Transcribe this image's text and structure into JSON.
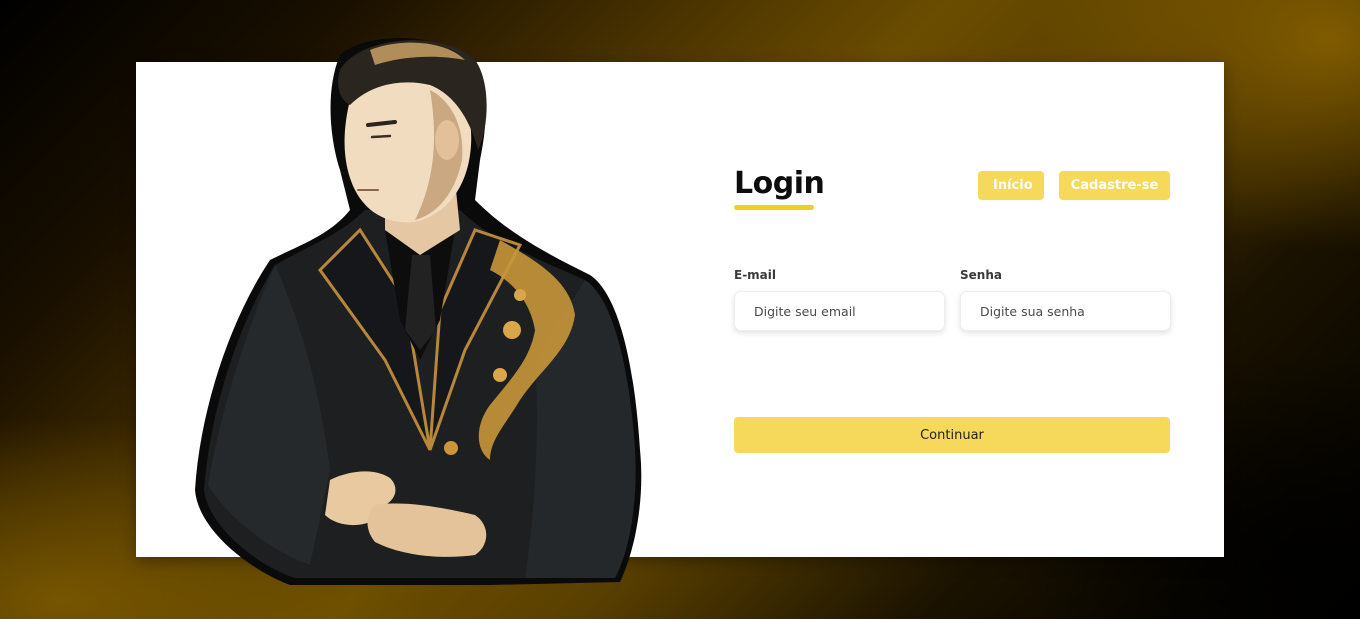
{
  "login": {
    "title": "Login",
    "nav": {
      "home_label": "Início",
      "signup_label": "Cadastre-se"
    },
    "email": {
      "label": "E-mail",
      "placeholder": "Digite seu email"
    },
    "password": {
      "label": "Senha",
      "placeholder": "Digite sua senha"
    },
    "submit_label": "Continuar"
  },
  "illustration": {
    "icon": "man-in-suit-illustration"
  },
  "colors": {
    "accent": "#f6d95a",
    "underline": "#f2cf1f",
    "background_gold": "#6b4d00",
    "background_dark": "#000000",
    "suit": "#1c1c1c",
    "ornament": "#c9963a"
  }
}
